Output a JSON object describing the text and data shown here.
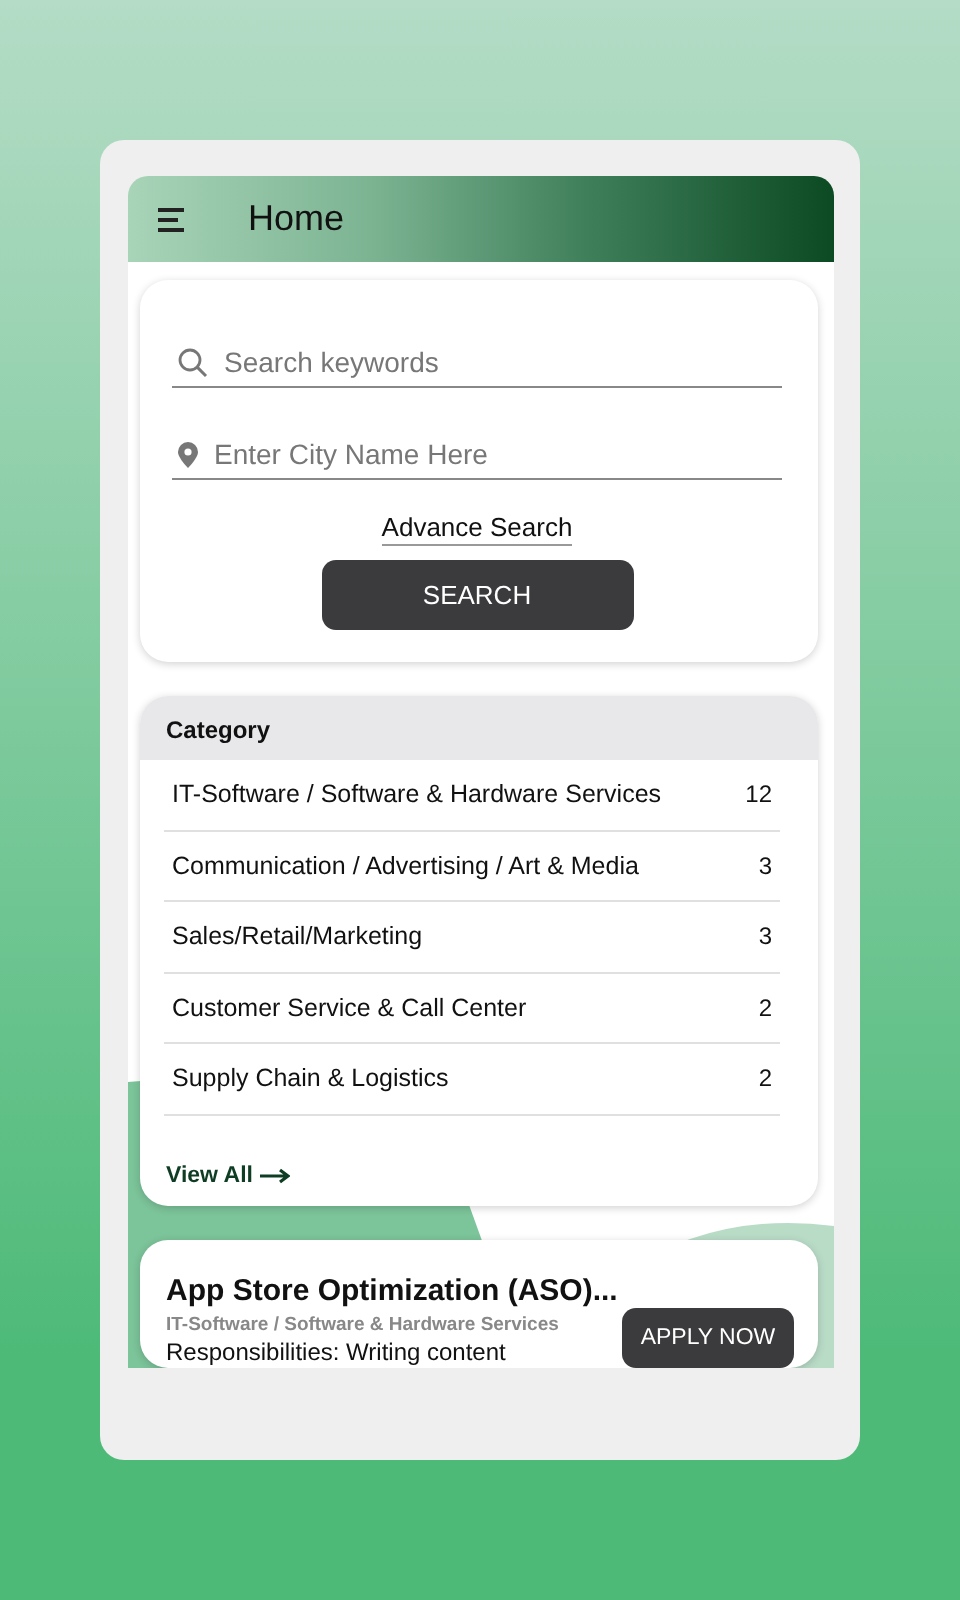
{
  "app_bar": {
    "title": "Home"
  },
  "search_card": {
    "keyword_field": {
      "placeholder": "Search keywords"
    },
    "city_field": {
      "placeholder": "Enter City Name Here"
    },
    "advance_link": "Advance Search",
    "search_button": "SEARCH"
  },
  "category_card": {
    "title": "Category",
    "items": [
      {
        "label": "IT-Software / Software & Hardware Services",
        "count": "12"
      },
      {
        "label": "Communication / Advertising / Art & Media",
        "count": "3"
      },
      {
        "label": "Sales/Retail/Marketing",
        "count": "3"
      },
      {
        "label": "Customer Service & Call Center",
        "count": "2"
      },
      {
        "label": "Supply Chain & Logistics",
        "count": "2"
      }
    ],
    "view_all": "View All"
  },
  "job_card": {
    "title": "App Store Optimization (ASO)...",
    "category": "IT-Software / Software & Hardware Services",
    "description": "Responsibilities:  Writing content",
    "apply_button": "APPLY NOW"
  }
}
